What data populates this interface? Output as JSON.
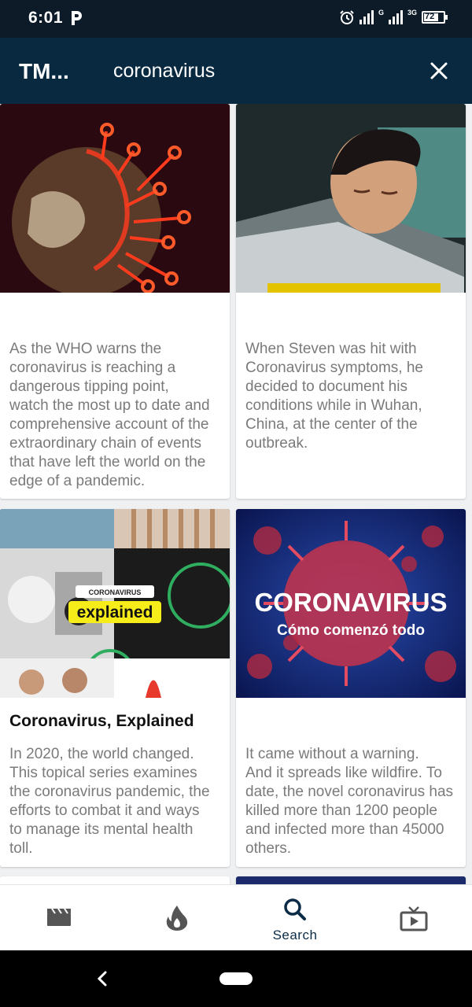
{
  "status_bar": {
    "time": "6:01",
    "network_label": "G",
    "network_label2": "3G",
    "battery": "72"
  },
  "header": {
    "brand": "TM...",
    "search_query": "coronavirus",
    "close_icon": "close-icon"
  },
  "results": [
    {
      "title": "",
      "description": "As the WHO warns the\ncoronavirus is reaching a\ndangerous tipping point,\nwatch the most up to date and\ncomprehensive account of the\nextraordinary chain of events\nthat have left the world on the\nedge of a pandemic."
    },
    {
      "title": "",
      "description": "When Steven was hit with\nCoronavirus symptoms, he\ndecided to document his\nconditions while in Wuhan,\nChina, at the center of the\noutbreak."
    },
    {
      "title": "Coronavirus, Explained",
      "thumb_tag": "CORONAVIRUS",
      "thumb_word": "explained",
      "description": "In 2020, the world changed.\nThis topical series examines\nthe coronavirus pandemic, the\nefforts to combat it and ways\nto manage its mental health\ntoll."
    },
    {
      "title": "",
      "thumb_title": "CORONAVIRUS",
      "thumb_subtitle": "Cómo comenzó todo",
      "description": "It came without a warning.\nAnd it spreads like wildfire. To\ndate, the novel coronavirus has\nkilled more than 1200 people\nand infected more than 45000\nothers."
    }
  ],
  "bottom_nav": {
    "items": [
      {
        "icon": "clapperboard-icon",
        "label": ""
      },
      {
        "icon": "flame-icon",
        "label": ""
      },
      {
        "icon": "search-icon",
        "label": "Search",
        "active": true
      },
      {
        "icon": "tv-play-icon",
        "label": ""
      }
    ]
  },
  "colors": {
    "status_bar": "#0d1b29",
    "app_bar": "#092941",
    "accent": "#0b2b46",
    "description_text": "#7a7a7a"
  }
}
